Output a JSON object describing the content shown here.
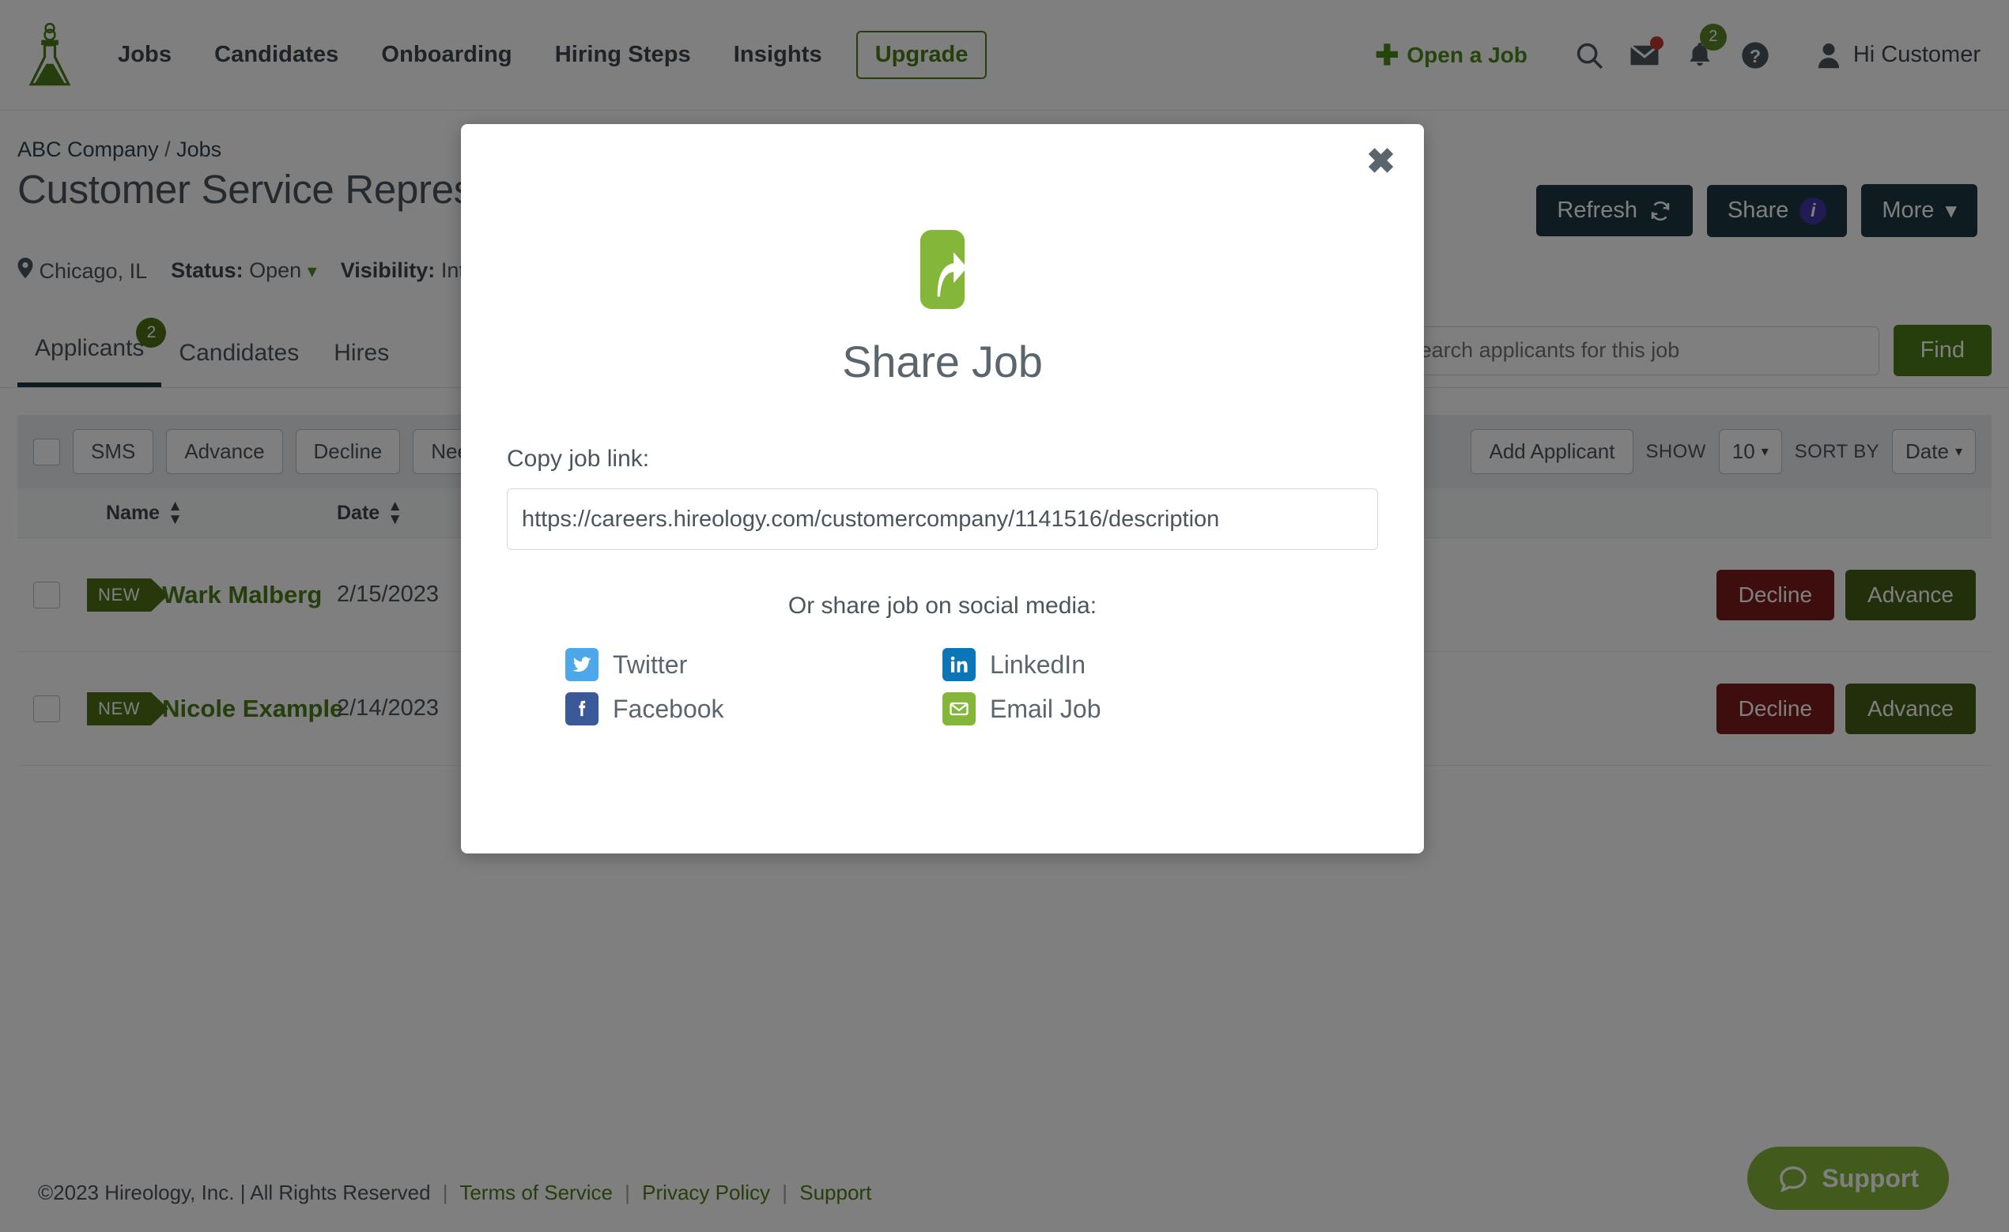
{
  "nav": {
    "logo_name": "hireology-flask-logo",
    "links": [
      "Jobs",
      "Candidates",
      "Onboarding",
      "Hiring Steps",
      "Insights"
    ],
    "upgrade_label": "Upgrade",
    "open_job_label": "Open a Job",
    "mail_badge": "",
    "bell_badge": "2",
    "user_greeting": "Hi Customer"
  },
  "job": {
    "breadcrumb_company": "ABC Company",
    "breadcrumb_sep": "/",
    "breadcrumb_section": "Jobs",
    "title": "Customer Service Representative",
    "location": "Chicago, IL",
    "status_label": "Status:",
    "status_value": "Open",
    "visibility_label": "Visibility:",
    "visibility_value": "Internal",
    "refresh_label": "Refresh",
    "share_label": "Share",
    "share_info_glyph": "i",
    "more_label": "More"
  },
  "tabs": [
    {
      "label": "Applicants",
      "badge": "2",
      "active": true
    },
    {
      "label": "Candidates",
      "badge": "",
      "active": false
    },
    {
      "label": "Hires",
      "badge": "",
      "active": false
    }
  ],
  "search": {
    "placeholder": "Search applicants for this job",
    "find_label": "Find"
  },
  "toolbar": {
    "buttons": [
      "SMS",
      "Advance",
      "Decline",
      "Needs Review"
    ],
    "add_applicant_label": "Add Applicant",
    "show_label": "SHOW",
    "show_value": "10",
    "sort_label": "SORT BY",
    "sort_value": "Date"
  },
  "table": {
    "columns": {
      "name": "Name",
      "date": "Date"
    },
    "rows": [
      {
        "badge": "NEW",
        "name": "Wark Malberg",
        "date": "2/15/2023",
        "decline": "Decline",
        "advance": "Advance"
      },
      {
        "badge": "NEW",
        "name": "Nicole Example",
        "date": "2/14/2023",
        "decline": "Decline",
        "advance": "Advance"
      }
    ]
  },
  "modal": {
    "close_glyph": "✖",
    "icon_name": "share-arrow-icon",
    "title": "Share Job",
    "copy_label": "Copy job link:",
    "link_value": "https://careers.hireology.com/customercompany/1141516/description",
    "social_label": "Or share job on social media:",
    "social": [
      {
        "name": "Twitter",
        "icon": "twitter-icon",
        "color": "#4da7e8"
      },
      {
        "name": "LinkedIn",
        "icon": "linkedin-icon",
        "color": "#0b76b7"
      },
      {
        "name": "Facebook",
        "icon": "facebook-icon",
        "color": "#3b5998"
      },
      {
        "name": "Email Job",
        "icon": "email-icon",
        "color": "#84b639"
      }
    ]
  },
  "footer": {
    "copyright": "©2023 Hireology, Inc. | All Rights Reserved",
    "links": [
      "Terms of Service",
      "Privacy Policy",
      "Support"
    ],
    "support_widget_label": "Support"
  },
  "colors": {
    "brand_green": "#4a7c18",
    "dark_navy": "#1d3640",
    "accent_purple": "#4335a7",
    "danger_red": "#7d1c1c",
    "support_green": "#84b639"
  }
}
